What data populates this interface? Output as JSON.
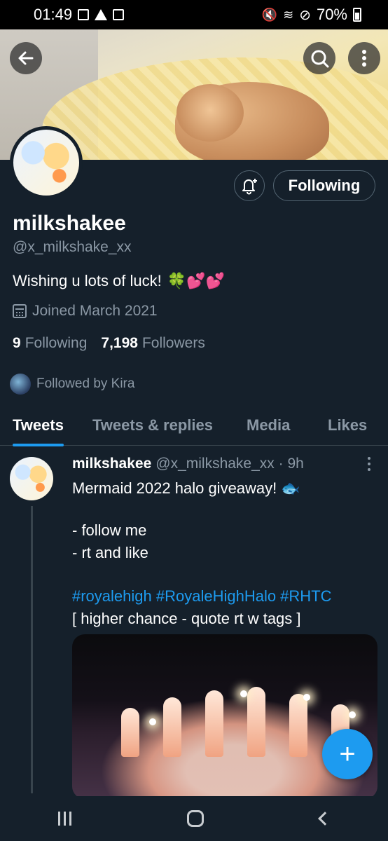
{
  "status_bar": {
    "time": "01:49",
    "battery": "70%"
  },
  "header": {
    "back_icon": "back-arrow-icon",
    "search_icon": "search-icon",
    "more_icon": "more-vertical-icon"
  },
  "profile": {
    "name": "milkshakee",
    "handle": "@x_milkshake_xx",
    "bio_text": "Wishing u lots of luck!",
    "bio_emoji": "🍀💕💕",
    "joined": "Joined March 2021",
    "following_count": "9",
    "following_label": "Following",
    "followers_count": "7,198",
    "followers_label": "Followers",
    "followed_by": "Followed by Kira",
    "follow_button": "Following"
  },
  "tabs": [
    {
      "label": "Tweets",
      "active": true
    },
    {
      "label": "Tweets & replies",
      "active": false
    },
    {
      "label": "Media",
      "active": false
    },
    {
      "label": "Likes",
      "active": false
    }
  ],
  "tweet": {
    "author": "milkshakee",
    "meta": "@x_milkshake_xx · 9h",
    "line1": "Mermaid 2022 halo giveaway! 🐟",
    "line2": "- follow me",
    "line3": "- rt and like",
    "tags": "#royalehigh #RoyaleHighHalo #RHTC",
    "line4": "[ higher chance - quote rt w tags ]"
  },
  "fab": {
    "label": "+"
  },
  "colors": {
    "background": "#15202b",
    "accent": "#1d9bf0",
    "muted": "#8b98a5",
    "divider": "#38444d"
  }
}
